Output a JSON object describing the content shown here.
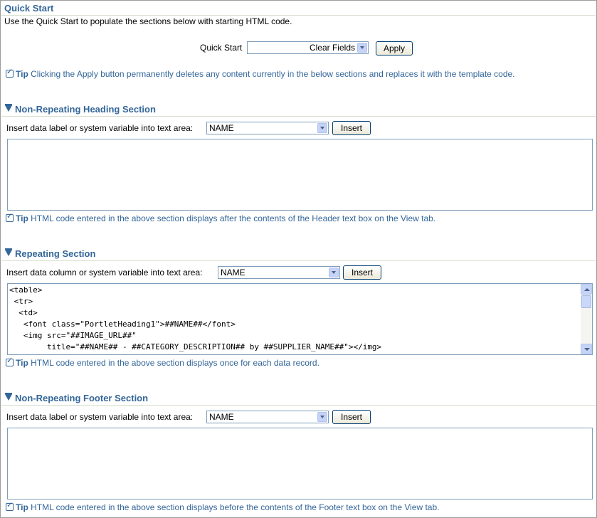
{
  "quick_start": {
    "title": "Quick Start",
    "description": "Use the Quick Start to populate the sections below with starting HTML code.",
    "label": "Quick Start",
    "select_value": "Clear Fields",
    "apply_label": "Apply",
    "tip_word": "Tip",
    "tip_text": "Clicking the Apply button permanently deletes any content currently in the below sections and replaces it with the template code."
  },
  "heading_section": {
    "title": "Non-Repeating Heading Section",
    "insert_label": "Insert data label or system variable into text area:",
    "select_value": "NAME",
    "insert_button": "Insert",
    "textarea_value": "",
    "tip_word": "Tip",
    "tip_text": "HTML code entered in the above section displays after the contents of the Header text box on the View tab."
  },
  "repeating_section": {
    "title": "Repeating Section",
    "insert_label": "Insert data column or system variable into text area:",
    "select_value": "NAME",
    "insert_button": "Insert",
    "code_lines": [
      "<table>",
      " <tr>",
      "  <td>",
      "   <font class=\"PortletHeading1\">##NAME##</font>",
      "   <img src=\"##IMAGE_URL##\"",
      "        title=\"##NAME## - ##CATEGORY_DESCRIPTION## by ##SUPPLIER_NAME##\"></img>"
    ],
    "tip_word": "Tip",
    "tip_text": "HTML code entered in the above section displays once for each data record."
  },
  "footer_section": {
    "title": "Non-Repeating Footer Section",
    "insert_label": "Insert data label or system variable into text area:",
    "select_value": "NAME",
    "insert_button": "Insert",
    "textarea_value": "",
    "tip_word": "Tip",
    "tip_text": "HTML code entered in the above section displays before the contents of the Footer text box on the View tab."
  },
  "colors": {
    "accent": "#336699",
    "border": "#7f9db9"
  }
}
